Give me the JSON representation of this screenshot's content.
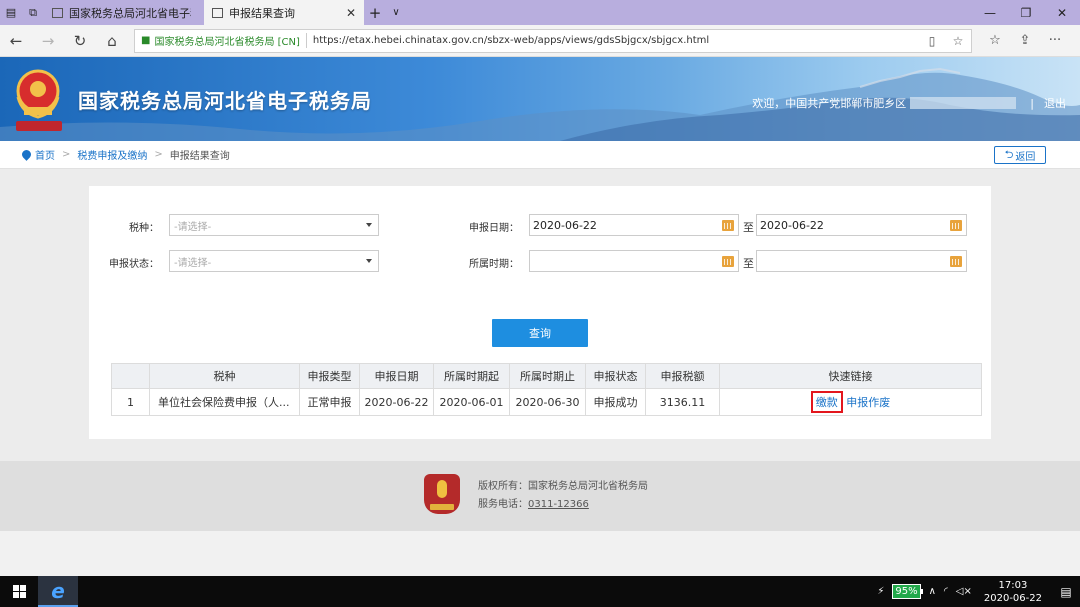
{
  "browser": {
    "tabs": [
      {
        "label": "国家税务总局河北省电子税务局",
        "active": false
      },
      {
        "label": "申报结果查询",
        "active": true
      }
    ],
    "cert_label": "国家税务总局河北省税务局 [CN]",
    "url": "https://etax.hebei.chinatax.gov.cn/sbzx-web/apps/views/gdsSbjgcx/sbjgcx.html"
  },
  "header": {
    "title": "国家税务总局河北省电子税务局",
    "welcome": "欢迎，中国共产党邯郸市肥乡区",
    "divider": "|",
    "logout": "退出"
  },
  "breadcrumb": {
    "home": "首页",
    "sep": ">",
    "level1": "税费申报及缴纳",
    "current": "申报结果查询",
    "back_label": "返回"
  },
  "form": {
    "tax_type_label": "税种：",
    "tax_type_placeholder": "-请选择-",
    "status_label": "申报状态：",
    "status_placeholder": "-请选择-",
    "decl_date_label": "申报日期：",
    "decl_date_from": "2020-06-22",
    "decl_date_to": "2020-06-22",
    "period_label": "所属时期：",
    "period_from": "",
    "period_to": "",
    "to_label": "至",
    "query_button": "查询"
  },
  "table": {
    "headers": [
      "",
      "税种",
      "申报类型",
      "申报日期",
      "所属时期起",
      "所属时期止",
      "申报状态",
      "申报税额",
      "快速链接"
    ],
    "rows": [
      {
        "index": "1",
        "tax_type": "单位社会保险费申报（人...",
        "decl_type": "正常申报",
        "decl_date": "2020-06-22",
        "period_start": "2020-06-01",
        "period_end": "2020-06-30",
        "status": "申报成功",
        "amount": "3136.11",
        "link_pay": "缴款",
        "link_void": "申报作废"
      }
    ]
  },
  "footer": {
    "copyright": "版权所有：国家税务总局河北省税务局",
    "phone_label": "服务电话：",
    "phone": "0311-12366"
  },
  "taskbar": {
    "battery": "95%",
    "time": "17:03",
    "date": "2020-06-22"
  },
  "colors": {
    "header_blue": "#1b67b8",
    "link_blue": "#1a73c8",
    "button_blue": "#1e8ee0",
    "highlight_red": "#e3161d",
    "calendar_orange": "#e8a33c"
  }
}
